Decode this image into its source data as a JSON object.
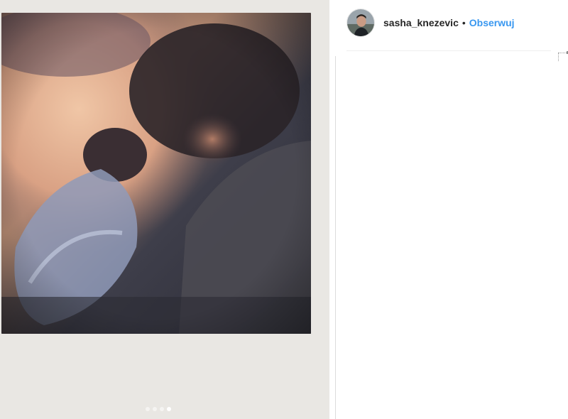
{
  "post": {
    "media": {
      "carousel_total": 4,
      "carousel_active_index": 4
    },
    "author": {
      "username": "sasha_knezevic",
      "separator": "•",
      "follow_label": "Obserwuj"
    }
  },
  "colors": {
    "follow_blue": "#3897f0",
    "username_text": "#262626",
    "media_background": "#e9e7e3",
    "divider": "#efefef"
  },
  "icons": [
    "avatar-image"
  ]
}
